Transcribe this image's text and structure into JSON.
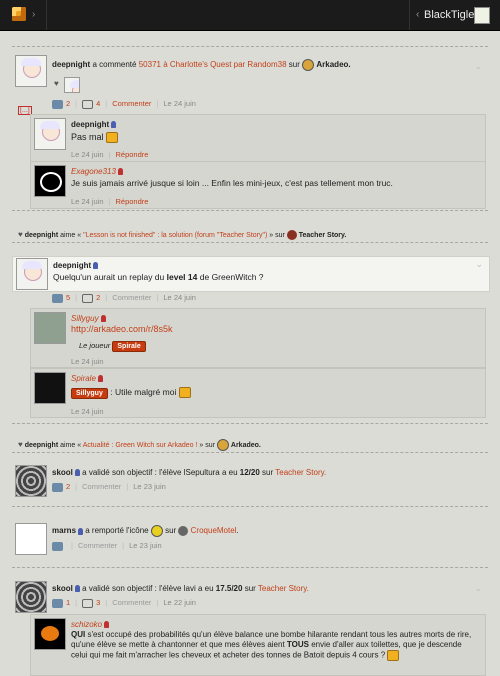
{
  "topbar": {
    "username": "BlackTigle"
  },
  "feed": {
    "post1": {
      "user": "deepnight",
      "action": "a commenté",
      "target": "50371 à Charlotte's Quest par Random38",
      "on": "sur",
      "game": "Arkadeo.",
      "likes": "2",
      "comments": "4",
      "comment_label": "Commenter",
      "date": "Le 24 juin"
    },
    "more_label": "[...]",
    "reply1": {
      "user": "deepnight",
      "text": "Pas mal",
      "date": "Le 24 juin",
      "reply_label": "Répondre"
    },
    "reply2": {
      "user": "Exagone313",
      "text": "Je suis jamais arrivé jusque si loin ... Enfin les mini-jeux, c'est pas tellement mon truc.",
      "date": "Le 24 juin",
      "reply_label": "Répondre"
    },
    "like1": {
      "user": "deepnight",
      "verb": "aime «",
      "quote": "\"Lesson is not finished\" : la solution (forum \"Teacher Story\")",
      "suffix": "» sur",
      "game": "Teacher Story."
    },
    "post2": {
      "user": "deepnight",
      "text_before": "Quelqu'un aurait un replay du",
      "text_bold": "level 14",
      "text_after": "de GreenWitch ?",
      "likes": "5",
      "comments": "2",
      "comment_label": "Commenter",
      "date": "Le 24 juin"
    },
    "reply3": {
      "user": "Sillyguy",
      "link": "http://arkadeo.com/r/8s5k",
      "role_prefix": "Le joueur",
      "role_badge": "Spirale",
      "date": "Le 24 juin"
    },
    "reply4": {
      "user": "Spirale",
      "badge": "Sillyguy",
      "text": ": Utile malgré moi",
      "date": "Le 24 juin"
    },
    "like2": {
      "user": "deepnight",
      "verb": "aime «",
      "quote": "Actualité : Green Witch sur Arkadeo !",
      "suffix": "» sur",
      "game": "Arkadeo."
    },
    "post3": {
      "user": "skool",
      "action": "a validé son objectif : l'élève lSepultura a eu",
      "score": "12/20",
      "on": "sur",
      "game": "Teacher Story.",
      "likes": "2",
      "comment_label": "Commenter",
      "date": "Le 23 juin"
    },
    "post4": {
      "user": "marns",
      "action": "a remporté l'icône",
      "on": "sur",
      "game": "CroqueMotel",
      "suffix": ".",
      "comment_label": "Commenter",
      "date": "Le 23 juin"
    },
    "post5": {
      "user": "skool",
      "action": "a validé son objectif : l'élève lavi a eu",
      "score": "17.5/20",
      "on": "sur",
      "game": "Teacher Story.",
      "likes": "1",
      "comments": "3",
      "comment_label": "Commenter",
      "date": "Le 22 juin"
    },
    "reply5": {
      "user": "schizoko",
      "text_start": "QUI",
      "text_mid": " s'est occupé des probabilités qu'un élève balance une bombe hilarante rendant tous les autres morts de rire, qu'une élève se mette à chantonner et que mes élèves aient ",
      "text_bold": "TOUS",
      "text_end": " envie d'aller aux toilettes, que je descende celui qui me fait m'arracher les cheveux et acheter des tonnes de Batoit depuis 4 cours ?"
    }
  },
  "colors": {
    "accent": "#c0401a",
    "background": "#dcdcd6",
    "topbar": "#1b1b1b",
    "badge": "#c63c10"
  }
}
